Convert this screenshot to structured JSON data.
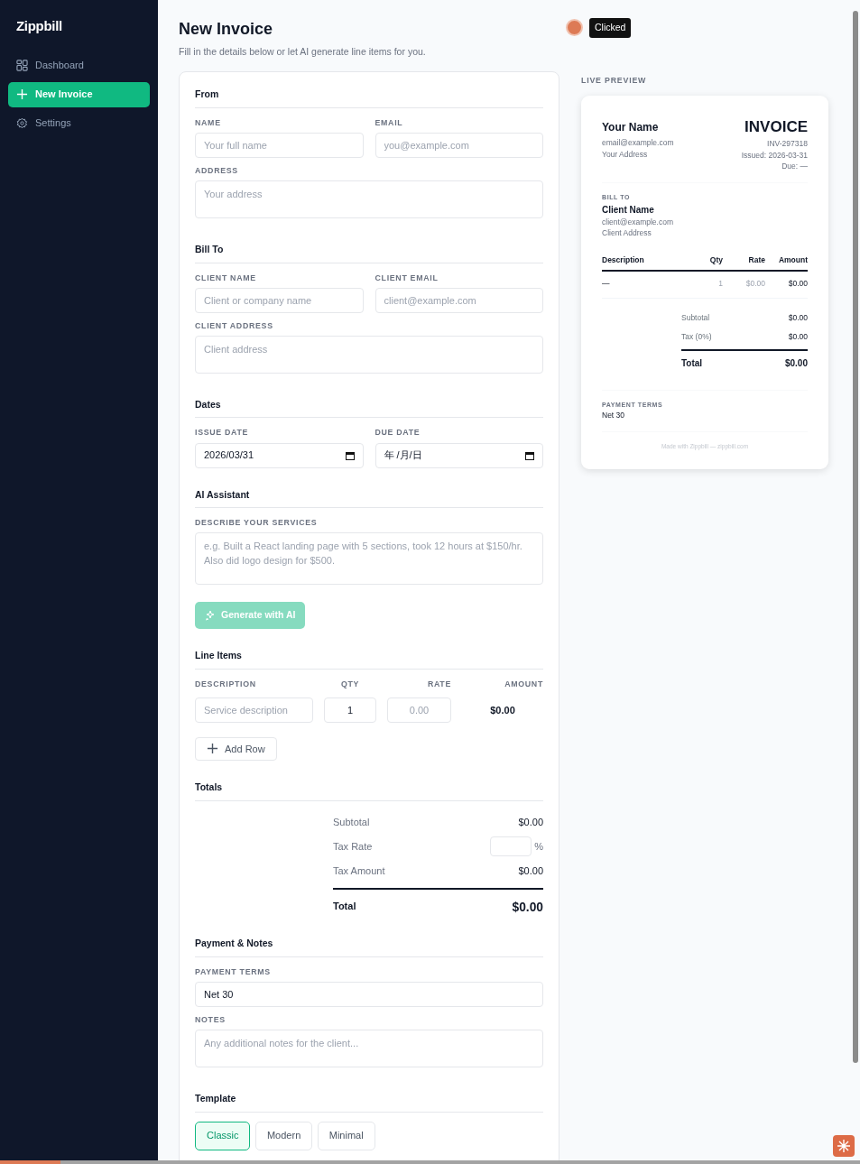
{
  "sidebar": {
    "brand": "Zippbill",
    "items": [
      {
        "label": "Dashboard",
        "selected": false
      },
      {
        "label": "New Invoice",
        "selected": true
      },
      {
        "label": "Settings",
        "selected": false
      }
    ]
  },
  "header": {
    "title": "New Invoice",
    "subtitle": "Fill in the details below or let AI generate line items for you."
  },
  "click_marker": {
    "label": "Clicked"
  },
  "form": {
    "sections": [
      {
        "kind": "fields",
        "title": "From",
        "rows": [
          [
            {
              "kind": "input",
              "label": "NAME",
              "placeholder": "Your full name"
            },
            {
              "kind": "input",
              "label": "EMAIL",
              "placeholder": "you@example.com"
            }
          ],
          [
            {
              "kind": "textarea",
              "label": "ADDRESS",
              "placeholder": "Your address"
            }
          ]
        ]
      },
      {
        "kind": "fields",
        "title": "Bill To",
        "rows": [
          [
            {
              "kind": "input",
              "label": "CLIENT NAME",
              "placeholder": "Client or company name"
            },
            {
              "kind": "input",
              "label": "CLIENT EMAIL",
              "placeholder": "client@example.com"
            }
          ],
          [
            {
              "kind": "textarea",
              "label": "CLIENT ADDRESS",
              "placeholder": "Client address"
            }
          ]
        ]
      },
      {
        "kind": "fields",
        "title": "Dates",
        "rows": [
          [
            {
              "kind": "date",
              "label": "ISSUE DATE",
              "value": "2026/03/31"
            },
            {
              "kind": "date",
              "label": "DUE DATE",
              "value": "年 /月/日"
            }
          ]
        ]
      },
      {
        "kind": "ai",
        "title": "AI Assistant",
        "label": "DESCRIBE YOUR SERVICES",
        "placeholder": "e.g. Built a React landing page with 5 sections, took 12 hours at $150/hr.\nAlso did logo design for $500.",
        "button": "Generate with AI",
        "disabled": true
      },
      {
        "kind": "line_items",
        "title": "Line Items",
        "columns": [
          "DESCRIPTION",
          "QTY",
          "RATE",
          "AMOUNT"
        ],
        "rows": [
          {
            "description_placeholder": "Service description",
            "qty": "1",
            "rate_placeholder": "0.00",
            "amount": "$0.00"
          }
        ],
        "add_button": "Add Row"
      },
      {
        "kind": "totals",
        "title": "Totals",
        "rows": [
          {
            "kind": "value",
            "label": "Subtotal",
            "value": "$0.00"
          },
          {
            "kind": "input",
            "label": "Tax Rate",
            "unit": "%"
          },
          {
            "kind": "value",
            "label": "Tax Amount",
            "value": "$0.00"
          }
        ],
        "total": {
          "label": "Total",
          "value": "$0.00"
        }
      },
      {
        "kind": "fields",
        "title": "Payment & Notes",
        "rows": [
          [
            {
              "kind": "input",
              "label": "PAYMENT TERMS",
              "value": "Net 30"
            }
          ],
          [
            {
              "kind": "textarea",
              "label": "NOTES",
              "placeholder": "Any additional notes for the client..."
            }
          ]
        ]
      },
      {
        "kind": "template",
        "title": "Template",
        "options": [
          {
            "label": "Classic",
            "selected": true
          },
          {
            "label": "Modern",
            "selected": false
          },
          {
            "label": "Minimal",
            "selected": false
          }
        ]
      }
    ]
  },
  "preview": {
    "label": "LIVE PREVIEW",
    "from": {
      "name": "Your Name",
      "email": "email@example.com",
      "address": "Your Address"
    },
    "title": "INVOICE",
    "number": "INV-297318",
    "issued": "Issued: 2026-03-31",
    "due": "Due: —",
    "bill_to": {
      "label": "BILL TO",
      "name": "Client Name",
      "email": "client@example.com",
      "address": "Client Address"
    },
    "columns": [
      "Description",
      "Qty",
      "Rate",
      "Amount"
    ],
    "rows": [
      [
        "—",
        "1",
        "$0.00",
        "$0.00"
      ]
    ],
    "totals": [
      {
        "label": "Subtotal",
        "value": "$0.00"
      },
      {
        "label": "Tax (0%)",
        "value": "$0.00"
      }
    ],
    "total": {
      "label": "Total",
      "value": "$0.00"
    },
    "terms_label": "PAYMENT TERMS",
    "terms": "Net 30",
    "footer": "Made with Zippbill — zippbill.com"
  }
}
